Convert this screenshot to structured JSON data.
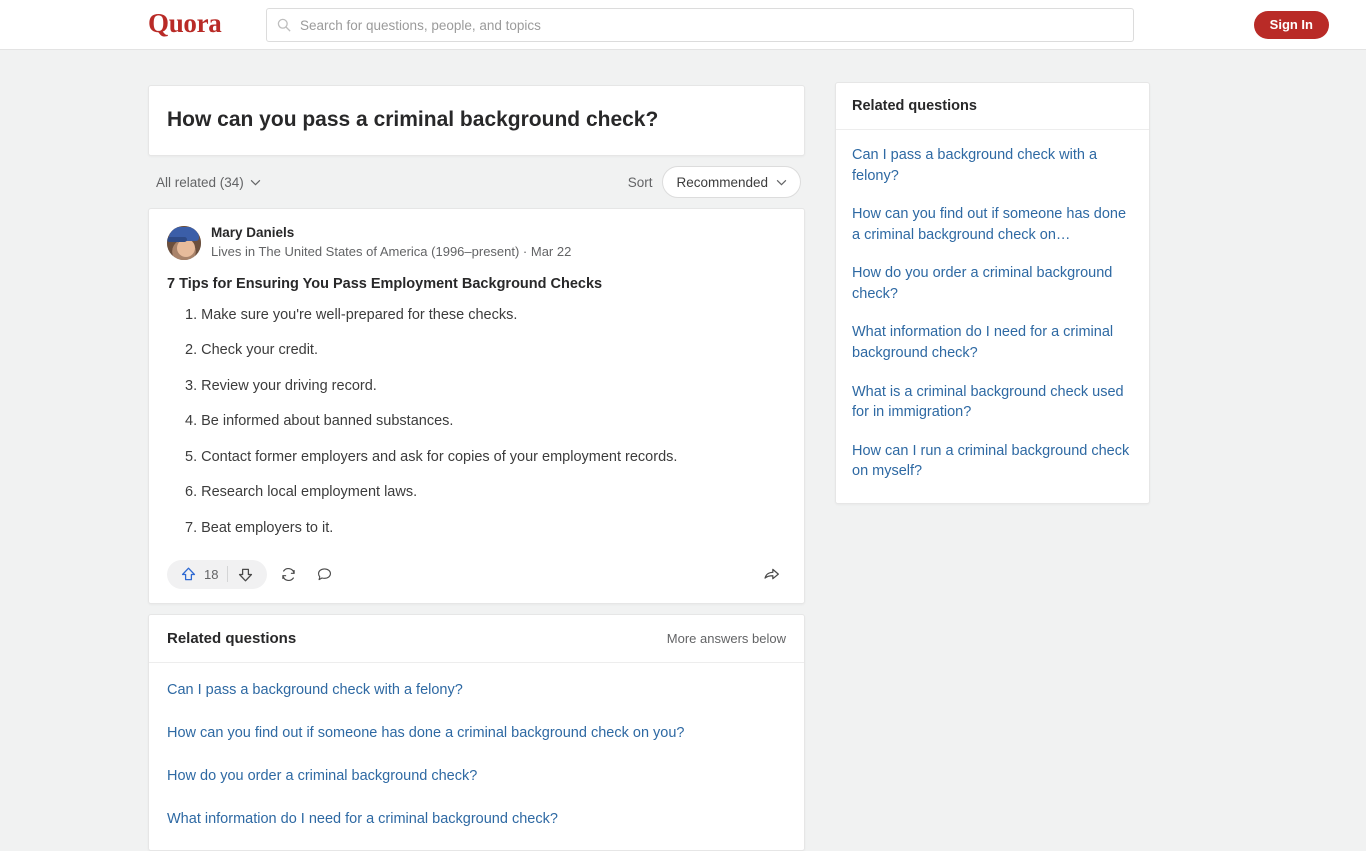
{
  "header": {
    "logo": "Quora",
    "search_placeholder": "Search for questions, people, and topics",
    "search_value": "",
    "sign_in": "Sign In",
    "brand_color": "#b92b27"
  },
  "question": {
    "title": "How can you pass a criminal background check?",
    "all_related": "All related (34)",
    "sort_label": "Sort",
    "sort_value": "Recommended"
  },
  "answer": {
    "author_name": "Mary Daniels",
    "author_meta": "Lives in The United States of America (1996–present) · Mar 22",
    "title": "7 Tips for Ensuring You Pass Employment Background Checks",
    "items": [
      "1. Make sure you're well-prepared for these checks.",
      "2. Check your credit.",
      "3. Review your driving record.",
      "4. Be informed about banned substances.",
      "5. Contact former employers and ask for copies of your employment records.",
      "6. Research local employment laws.",
      "7. Beat employers to it."
    ],
    "upvote_count": "18",
    "upvote_color": "#2e69d2"
  },
  "related_main": {
    "title": "Related questions",
    "more_label": "More answers below",
    "items": [
      "Can I pass a background check with a felony?",
      "How can you find out if someone has done a criminal background check on you?",
      "How do you order a criminal background check?",
      "What information do I need for a criminal background check?"
    ]
  },
  "sidebar": {
    "title": "Related questions",
    "items": [
      "Can I pass a background check with a felony?",
      "How can you find out if someone has done a criminal background check on…",
      "How do you order a criminal background check?",
      "What information do I need for a criminal background check?",
      "What is a criminal background check used for in immigration?",
      "How can I run a criminal background check on myself?"
    ],
    "link_color": "#2e69a3"
  }
}
